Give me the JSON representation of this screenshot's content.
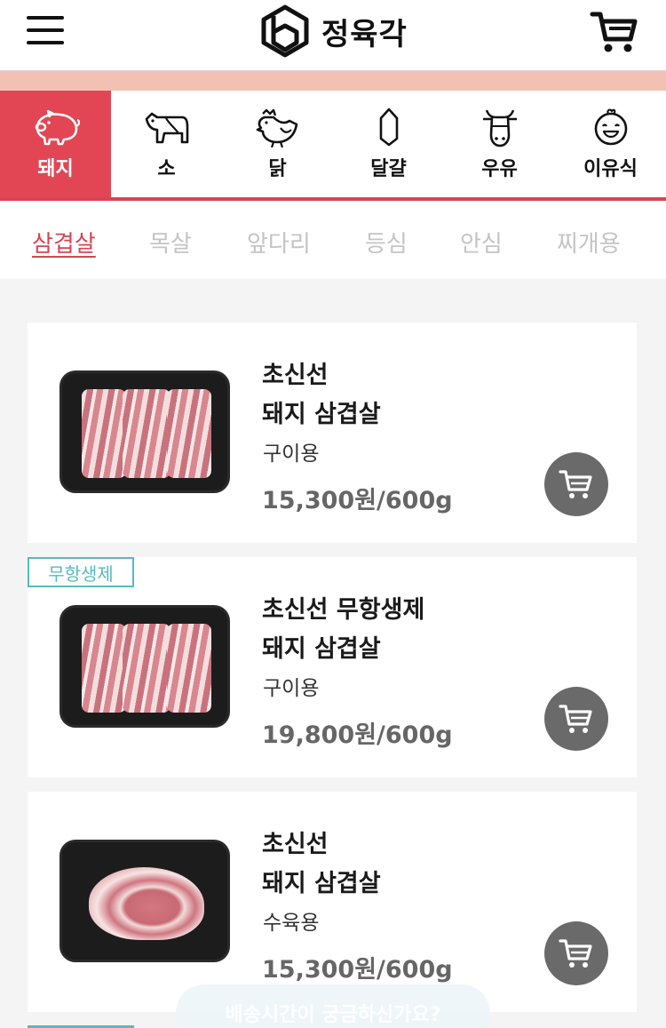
{
  "header": {
    "brand": "정육각"
  },
  "categories": [
    {
      "label": "돼지",
      "icon": "pig-icon",
      "active": true
    },
    {
      "label": "소",
      "icon": "cow-icon",
      "active": false
    },
    {
      "label": "닭",
      "icon": "chicken-icon",
      "active": false
    },
    {
      "label": "달걀",
      "icon": "egg-icon",
      "active": false
    },
    {
      "label": "우유",
      "icon": "milk-cow-icon",
      "active": false
    },
    {
      "label": "이유식",
      "icon": "baby-icon",
      "active": false
    }
  ],
  "subtabs": [
    {
      "label": "삼겹살",
      "active": true
    },
    {
      "label": "목살",
      "active": false
    },
    {
      "label": "앞다리",
      "active": false
    },
    {
      "label": "등심",
      "active": false
    },
    {
      "label": "안심",
      "active": false
    },
    {
      "label": "찌개용",
      "active": false
    }
  ],
  "products": [
    {
      "title_line1": "초신선",
      "title_line2": "돼지 삼겹살",
      "usage": "구이용",
      "price": "15,300원/600g",
      "tag": ""
    },
    {
      "title_line1": "초신선 무항생제",
      "title_line2": "돼지 삼겹살",
      "usage": "구이용",
      "price": "19,800원/600g",
      "tag": "무항생제"
    },
    {
      "title_line1": "초신선",
      "title_line2": "돼지 삼겹살",
      "usage": "수육용",
      "price": "15,300원/600g",
      "tag": ""
    }
  ],
  "floating_button": {
    "label": "배송시간이 궁금하신가요?"
  },
  "colors": {
    "accent": "#e24654",
    "tag": "#57b9c4",
    "banner": "#f3c1b4"
  }
}
